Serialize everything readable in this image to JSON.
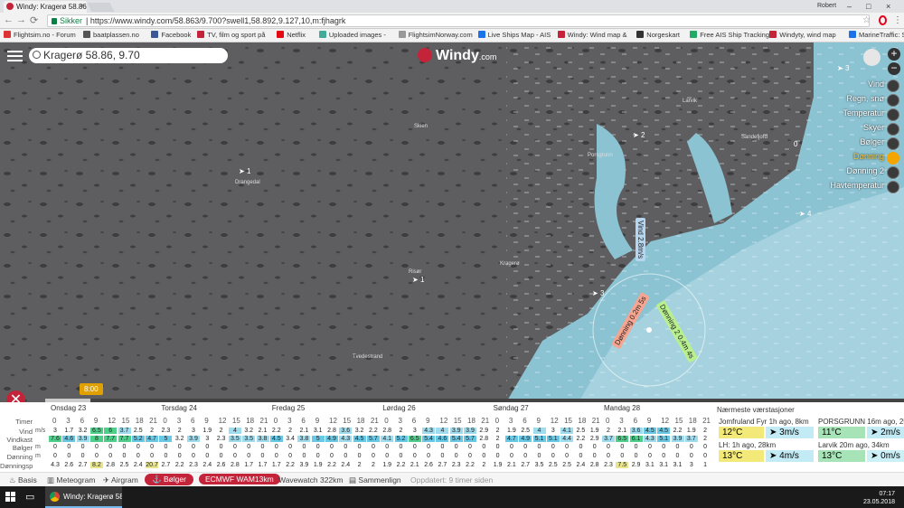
{
  "browser": {
    "tab_title": "Windy: Kragerø 58.86...",
    "user": "Robert",
    "secure_label": "Sikker",
    "url": "https://www.windy.com/58.863/9.700?swell1,58.892,9.127,10,m:fjhagrk"
  },
  "bookmarks": [
    {
      "label": "Flightsim.no - Forum",
      "color": "#d33"
    },
    {
      "label": "baatplassen.no",
      "color": "#555"
    },
    {
      "label": "Facebook",
      "color": "#3b5998"
    },
    {
      "label": "TV, film og sport på",
      "color": "#c4243a"
    },
    {
      "label": "Netflix",
      "color": "#e50914"
    },
    {
      "label": "Uploaded images -",
      "color": "#4a9"
    },
    {
      "label": "FlightsimNorway.com",
      "color": "#999"
    },
    {
      "label": "Live Ships Map - AIS",
      "color": "#1a73e8"
    },
    {
      "label": "Windy: Wind map &",
      "color": "#c4243a"
    },
    {
      "label": "Norgeskart",
      "color": "#333"
    },
    {
      "label": "Free AIS Ship Tracking",
      "color": "#2a6"
    },
    {
      "label": "Windyty, wind map",
      "color": "#c4243a"
    },
    {
      "label": "MarineTraffic: Sannt",
      "color": "#1a73e8"
    }
  ],
  "map": {
    "search_value": "Kragerø 58.86, 9.70",
    "logo": "Windy",
    "logo_suffix": ".com",
    "zoom_in": "+",
    "zoom_out": "−",
    "layers": [
      "Vind",
      "Regn, snø",
      "Temperatur",
      "Skyer",
      "Bølger",
      "Dønning",
      "Dønning 2",
      "Havtemperatur"
    ],
    "active_layer": "Dønning",
    "cities": [
      "Drangedal",
      "Skien",
      "Porsgrunn",
      "Sandefjord",
      "Larvik",
      "Kragerø",
      "Risør",
      "Tvedestrand"
    ],
    "wind_label": "Vind 2.8m/s",
    "swell_label": "Dønning 0.2m 5s",
    "swell2_label": "Dønning 2 0.4m 4s",
    "timeline_time": "8:00",
    "markers": [
      "1",
      "1",
      "2",
      "3",
      "3",
      "4",
      "0"
    ]
  },
  "forecast": {
    "days": [
      "Onsdag 23",
      "Torsdag 24",
      "Fredag 25",
      "Lørdag 26",
      "Søndag 27",
      "Mandag 28"
    ],
    "row_labels": [
      "Timer",
      "Vind",
      "Vindkast",
      "Bølger",
      "Dønning",
      "Dønningsp"
    ],
    "units": [
      "",
      "m/s",
      "",
      "m",
      "m",
      ""
    ],
    "hours": [
      "0",
      "3",
      "6",
      "9",
      "12",
      "15",
      "18",
      "21",
      "0",
      "3",
      "6",
      "9",
      "12",
      "15",
      "18",
      "21",
      "0",
      "3",
      "6",
      "9",
      "12",
      "15",
      "18",
      "21",
      "0",
      "3",
      "6",
      "9",
      "12",
      "15",
      "18",
      "21",
      "0",
      "3",
      "6",
      "9",
      "12",
      "15",
      "18",
      "21",
      "0",
      "3",
      "6",
      "9",
      "12",
      "15",
      "18",
      "21"
    ],
    "wind": [
      "3",
      "1.7",
      "3.2",
      "6.5",
      "6",
      "3.7",
      "2.5",
      "2",
      "2.3",
      "2",
      "3",
      "1.9",
      "2",
      "4",
      "3.2",
      "2.1",
      "2.2",
      "2",
      "2.1",
      "3.1",
      "2.8",
      "3.6",
      "3.2",
      "2.2",
      "2.8",
      "2",
      "3",
      "4.3",
      "4",
      "3.9",
      "3.9",
      "2.9",
      "2",
      "1.9",
      "2.5",
      "4",
      "3",
      "4.1",
      "2.5",
      "1.9",
      "2",
      "2.1",
      "3.6",
      "4.5",
      "4.5",
      "2.2",
      "1.9",
      "2"
    ],
    "gusts": [
      "7.6",
      "4.6",
      "3.9",
      "8",
      "7.7",
      "7.7",
      "5.2",
      "4.7",
      "5",
      "3.2",
      "3.9",
      "3",
      "2.3",
      "3.5",
      "3.5",
      "3.8",
      "4.5",
      "3.4",
      "3.8",
      "5",
      "4.9",
      "4.3",
      "4.5",
      "5.7",
      "4.1",
      "5.2",
      "6.5",
      "5.4",
      "4.6",
      "5.4",
      "5.7",
      "2.8",
      "2",
      "4.7",
      "4.9",
      "5.1",
      "5.1",
      "4.4",
      "2.2",
      "2.9",
      "3.7",
      "6.5",
      "6.1",
      "4.3",
      "5.1",
      "3.9",
      "3.7",
      "2"
    ],
    "waves": [
      "0",
      "0",
      "0",
      "0",
      "0",
      "0",
      "0",
      "0",
      "0",
      "0",
      "0",
      "0",
      "0",
      "0",
      "0",
      "0",
      "0",
      "0",
      "0",
      "0",
      "0",
      "0",
      "0",
      "0",
      "0",
      "0",
      "0",
      "0",
      "0",
      "0",
      "0",
      "0",
      "0",
      "0",
      "0",
      "0",
      "0",
      "0",
      "0",
      "0",
      "0",
      "0",
      "0",
      "0",
      "0",
      "0",
      "0",
      "0"
    ],
    "swell": [
      "0",
      "0",
      "0",
      "0",
      "0",
      "0",
      "0",
      "0",
      "0",
      "0",
      "0",
      "0",
      "0",
      "0",
      "0",
      "0",
      "0",
      "0",
      "0",
      "0",
      "0",
      "0",
      "0",
      "0",
      "0",
      "0",
      "0",
      "0",
      "0",
      "0",
      "0",
      "0",
      "0",
      "0",
      "0",
      "0",
      "0",
      "0",
      "0",
      "0",
      "0",
      "0",
      "0",
      "0",
      "0",
      "0",
      "0",
      "0"
    ],
    "swell_period": [
      "4.3",
      "2.6",
      "2.7",
      "8.2",
      "2.8",
      "2.5",
      "2.4",
      "20.7",
      "2.7",
      "2.2",
      "2.3",
      "2.4",
      "2.6",
      "2.8",
      "1.7",
      "1.7",
      "1.7",
      "2.2",
      "3.9",
      "1.9",
      "2.2",
      "2.4",
      "2",
      "2",
      "1.9",
      "2.2",
      "2.1",
      "2.6",
      "2.7",
      "2.3",
      "2.2",
      "2",
      "1.9",
      "2.1",
      "2.7",
      "3.5",
      "2.5",
      "2.5",
      "2.4",
      "2.8",
      "2.3",
      "7.5",
      "2.9",
      "3.1",
      "3.1",
      "3.1",
      "3",
      "1"
    ],
    "stations_title": "Nærmeste værstasjoner",
    "stations": [
      {
        "name": "Jomfruland Fyr",
        "ago": "1h ago, 8km",
        "temp": "12°C",
        "wind": "3m/s"
      },
      {
        "name": "PORSGRUNN",
        "ago": "16m ago, 25",
        "temp": "11°C",
        "wind": "2m/s"
      },
      {
        "name": "LH",
        "ago": "1h ago, 28km",
        "temp": "13°C",
        "wind": "4m/s"
      },
      {
        "name": "Larvik",
        "ago": "20m ago, 34km",
        "temp": "13°C",
        "wind": "0m/s"
      }
    ]
  },
  "bottom": {
    "basis": "Basis",
    "meteogram": "Meteogram",
    "airgram": "Airgram",
    "waves": "Bølger",
    "model1": "ECMWF WAM13km",
    "model2": "Wavewatch 322km",
    "compare": "Sammenlign",
    "updated": "Oppdatert: 9 timer siden"
  },
  "taskbar": {
    "item": "Windy: Kragerø 58...",
    "time": "07:17",
    "date": "23.05.2018"
  }
}
